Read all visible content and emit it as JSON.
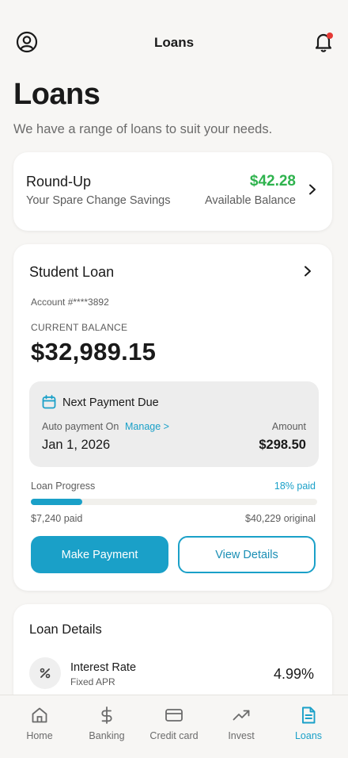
{
  "header": {
    "title": "Loans"
  },
  "page": {
    "title": "Loans",
    "subtitle": "We have a range of loans to suit your needs."
  },
  "roundup": {
    "title": "Round-Up",
    "subtitle": "Your Spare Change Savings",
    "amount": "$42.28",
    "amount_label": "Available Balance"
  },
  "student_loan": {
    "title": "Student Loan",
    "account": "Account #****3892",
    "balance_label": "CURRENT BALANCE",
    "balance": "$32,989.15",
    "next_payment": {
      "title": "Next Payment Due",
      "auto_label": "Auto payment On",
      "manage": "Manage >",
      "amount_label": "Amount",
      "date": "Jan 1, 2026",
      "amount": "$298.50"
    },
    "progress": {
      "label": "Loan Progress",
      "percent_label": "18% paid",
      "percent": 18,
      "paid": "$7,240 paid",
      "original": "$40,229 original"
    },
    "primary_button": "Make Payment",
    "secondary_button": "View Details"
  },
  "loan_details": {
    "title": "Loan Details",
    "rows": [
      {
        "title": "Interest Rate",
        "subtitle": "Fixed APR",
        "value": "4.99%"
      }
    ]
  },
  "tabs": [
    {
      "label": "Home",
      "icon": "home-icon"
    },
    {
      "label": "Banking",
      "icon": "dollar-icon"
    },
    {
      "label": "Credit card",
      "icon": "credit-card-icon"
    },
    {
      "label": "Invest",
      "icon": "trending-up-icon"
    },
    {
      "label": "Loans",
      "icon": "document-icon",
      "active": true
    }
  ],
  "colors": {
    "accent": "#1aa0c8",
    "positive": "#2fb34e",
    "notification": "#e53935"
  }
}
